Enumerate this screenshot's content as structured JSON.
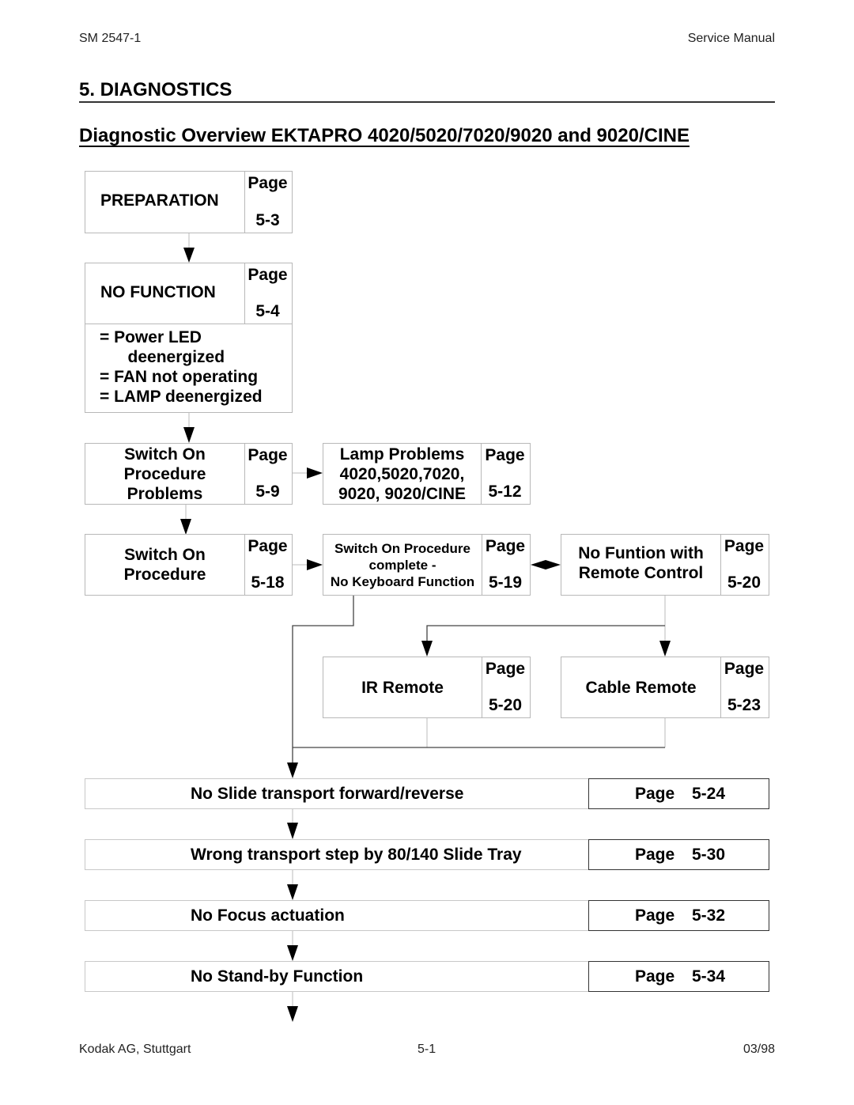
{
  "header": {
    "doc_id": "SM 2547-1",
    "doc_type": "Service Manual"
  },
  "section_title": "5. DIAGNOSTICS",
  "subtitle": "Diagnostic Overview EKTAPRO 4020/5020/7020/9020 and 9020/CINE",
  "page_label": "Page",
  "flowchart": {
    "preparation": {
      "label": "PREPARATION",
      "page": "5-3"
    },
    "no_function": {
      "label": "NO FUNCTION",
      "page": "5-4",
      "symptoms": [
        "= Power LED",
        "   deenergized",
        "= FAN not operating",
        "= LAMP deenergized"
      ]
    },
    "switch_on_problems": {
      "lines": [
        "Switch On",
        "Procedure",
        "Problems"
      ],
      "page": "5-9"
    },
    "lamp_problems": {
      "lines": [
        "Lamp Problems",
        "4020,5020,7020,",
        "9020, 9020/CINE"
      ],
      "page": "5-12"
    },
    "switch_on_procedure": {
      "lines": [
        "Switch On",
        "Procedure"
      ],
      "page": "5-18"
    },
    "no_keyboard": {
      "lines": [
        "Switch On Procedure",
        "complete -",
        "No Keyboard Function"
      ],
      "page": "5-19"
    },
    "no_remote": {
      "lines": [
        "No Funtion with",
        "Remote Control"
      ],
      "page": "5-20"
    },
    "ir_remote": {
      "label": "IR Remote",
      "page": "5-20"
    },
    "cable_remote": {
      "label": "Cable Remote",
      "page": "5-23"
    },
    "steps": [
      {
        "label": "No Slide transport forward/reverse",
        "page": "5-24"
      },
      {
        "label": "Wrong transport step by 80/140 Slide Tray",
        "page": "5-30"
      },
      {
        "label": "No Focus actuation",
        "page": "5-32"
      },
      {
        "label": "No Stand-by Function",
        "page": "5-34"
      }
    ]
  },
  "footer": {
    "company": "Kodak AG, Stuttgart",
    "page_number": "5-1",
    "date": "03/98"
  }
}
